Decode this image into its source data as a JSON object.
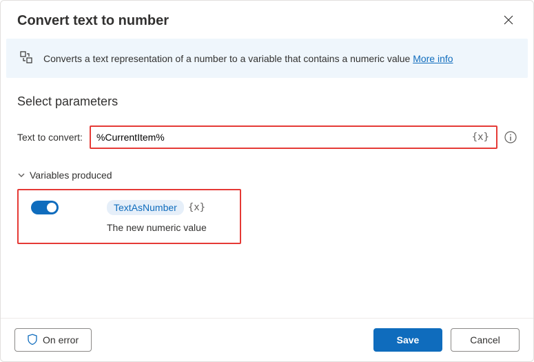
{
  "header": {
    "title": "Convert text to number"
  },
  "banner": {
    "text": "Converts a text representation of a number to a variable that contains a numeric value ",
    "link": "More info"
  },
  "section": {
    "title": "Select parameters"
  },
  "param": {
    "label": "Text to convert:",
    "value": "%CurrentItem%",
    "var_icon": "{x}"
  },
  "variables": {
    "header": "Variables produced",
    "name": "TextAsNumber",
    "type": "{x}",
    "desc": "The new numeric value"
  },
  "footer": {
    "on_error": "On error",
    "save": "Save",
    "cancel": "Cancel"
  }
}
